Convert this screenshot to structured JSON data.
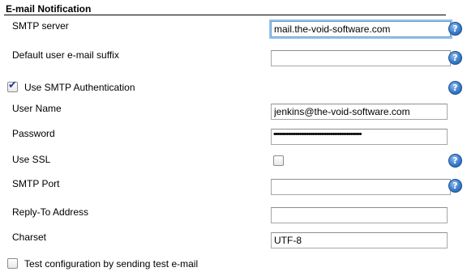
{
  "section": {
    "title": "E-mail Notification"
  },
  "fields": {
    "smtp_server": {
      "label": "SMTP server",
      "value": "mail.the-void-software.com"
    },
    "email_suffix": {
      "label": "Default user e-mail suffix",
      "value": ""
    },
    "use_smtp_auth": {
      "label": "Use SMTP Authentication",
      "checked": true
    },
    "user_name": {
      "label": "User Name",
      "value": "jenkins@the-void-software.com"
    },
    "password": {
      "label": "Password",
      "masked": "••••••••••••••••••••••••••••••••••••••••••••••••"
    },
    "use_ssl": {
      "label": "Use SSL",
      "checked": false
    },
    "smtp_port": {
      "label": "SMTP Port",
      "value": ""
    },
    "reply_to": {
      "label": "Reply-To Address",
      "value": ""
    },
    "charset": {
      "label": "Charset",
      "value": "UTF-8"
    },
    "test_config": {
      "label": "Test configuration by sending test e-mail",
      "checked": false
    }
  },
  "help": {
    "glyph": "?"
  },
  "checkbox": {
    "tick": "✔"
  }
}
